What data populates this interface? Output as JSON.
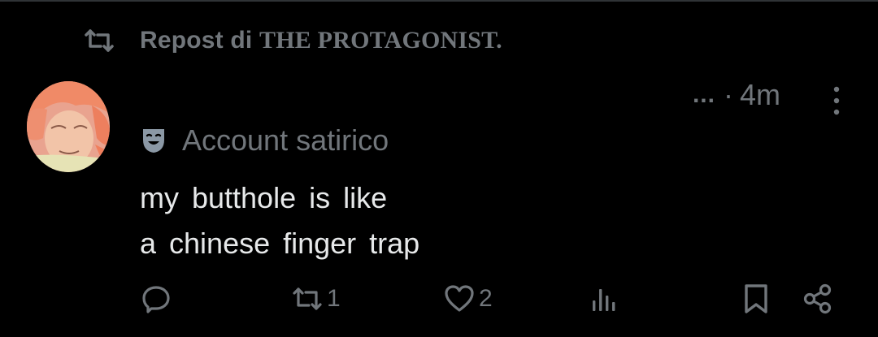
{
  "repost": {
    "prefix": "Repost di",
    "name": "THE PROTAGONIST."
  },
  "post": {
    "more_label": "...",
    "separator": "·",
    "time": "4m",
    "label": "Account satirico",
    "text_line1": "my butthole is like",
    "text_line2": "a chinese finger trap"
  },
  "actions": {
    "reposts": "1",
    "likes": "2"
  },
  "icons": {
    "repost": "repost-icon",
    "label": "theater-masks-icon",
    "reply": "reply-icon",
    "like": "heart-icon",
    "views": "views-icon",
    "bookmark": "bookmark-icon",
    "share": "share-icon",
    "more": "more-vertical-icon"
  },
  "colors": {
    "background": "#000000",
    "text": "#e7e9ea",
    "muted": "#71767b"
  }
}
